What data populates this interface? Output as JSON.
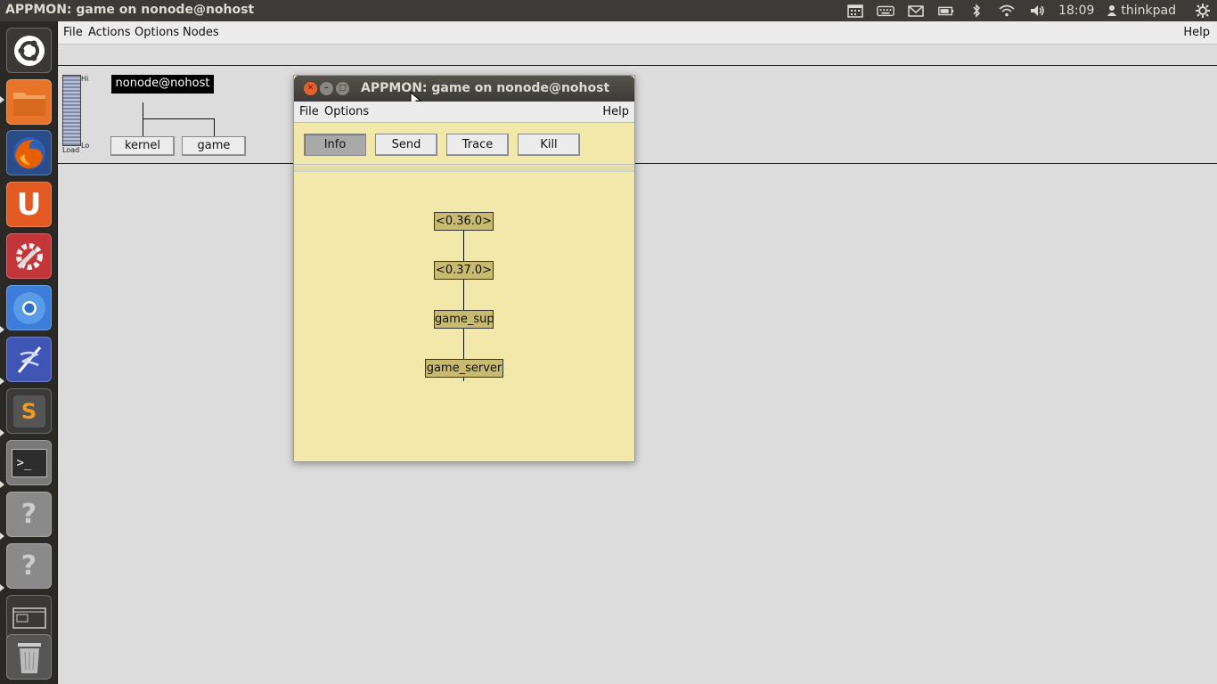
{
  "topbar": {
    "title": "APPMON: game on nonode@nohost",
    "time": "18:09",
    "user": "thinkpad"
  },
  "launcher": {
    "items": [
      {
        "name": "dash",
        "color": "#3a3936"
      },
      {
        "name": "files",
        "color": "#e8742a"
      },
      {
        "name": "firefox",
        "color": "#e66000"
      },
      {
        "name": "ubuntu-software",
        "color": "#e25a22"
      },
      {
        "name": "system-settings",
        "color": "#c2363a"
      },
      {
        "name": "chromium",
        "color": "#3b7dd8"
      },
      {
        "name": "gvim",
        "color": "#4056b5"
      },
      {
        "name": "sublime-text",
        "color": "#e07b1a"
      },
      {
        "name": "terminal",
        "color": "#2d2d2d"
      },
      {
        "name": "unknown-app-1",
        "color": "#8a8a8a"
      },
      {
        "name": "unknown-app-2",
        "color": "#8a8a8a"
      },
      {
        "name": "workspace-switcher",
        "color": "#3a3936"
      },
      {
        "name": "trash",
        "color": "#555555"
      }
    ]
  },
  "main": {
    "menu": {
      "file": "File",
      "actions": "Actions",
      "options": "Options",
      "nodes": "Nodes",
      "help": "Help"
    },
    "load": {
      "hi": "Hi",
      "lo": "Lo",
      "load": "Load"
    },
    "node": "nonode@nohost",
    "apps": {
      "kernel": "kernel",
      "game": "game"
    }
  },
  "dialog": {
    "title": "APPMON: game on nonode@nohost",
    "menu": {
      "file": "File",
      "options": "Options",
      "help": "Help"
    },
    "buttons": {
      "info": "Info",
      "send": "Send",
      "trace": "Trace",
      "kill": "Kill"
    },
    "tree": {
      "p1": "<0.36.0>",
      "p2": "<0.37.0>",
      "sup": "game_sup",
      "server": "game_server"
    }
  }
}
